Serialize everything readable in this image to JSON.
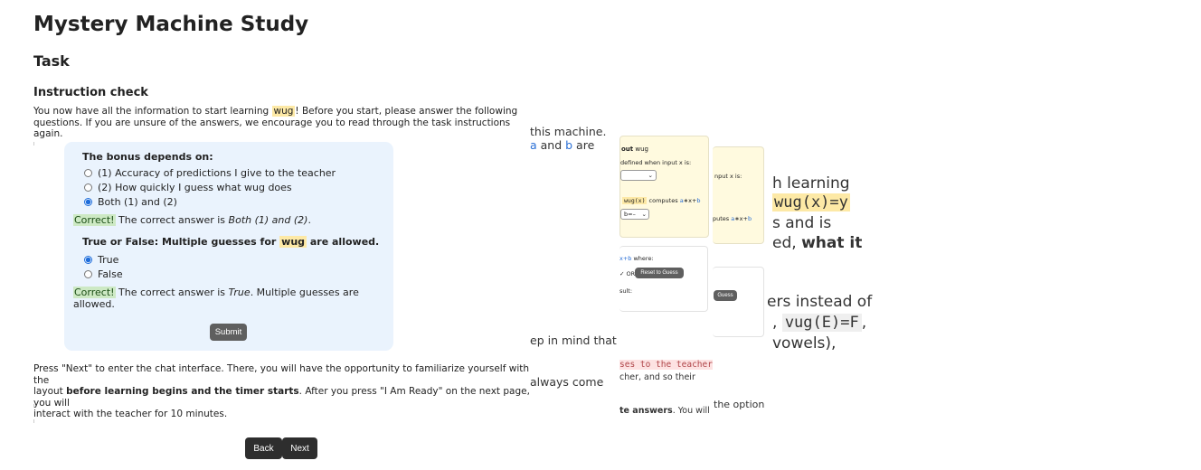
{
  "page": {
    "title": "Mystery Machine Study",
    "section": "Task",
    "subsection": "Instruction check",
    "intro": {
      "before": "You now have all the information to start learning ",
      "word": "wug",
      "after": "! Before you start, please answer the following",
      "line2": "questions. If you are unsure of the answers, we encourage you to read through the task instructions again."
    }
  },
  "quiz": {
    "q1": {
      "question": "The bonus depends on:",
      "options": [
        "(1) Accuracy of predictions I give to the teacher",
        "(2) How quickly I guess what wug does",
        "Both (1) and (2)"
      ],
      "selected": 2,
      "feedback_tag": "Correct!",
      "feedback_before": " The correct answer is ",
      "feedback_answer": "Both (1) and (2)",
      "feedback_after": "."
    },
    "q2": {
      "question_before": "True or False: Multiple guesses for ",
      "question_word": "wug",
      "question_after": " are allowed.",
      "options": [
        "True",
        "False"
      ],
      "selected": 0,
      "feedback_tag": "Correct!",
      "feedback_before": " The correct answer is ",
      "feedback_answer": "True",
      "feedback_after": ". Multiple guesses are allowed."
    },
    "submit_label": "Submit"
  },
  "outro": {
    "line1": "Press \"Next\" to enter the chat interface. There, you will have the opportunity to familiarize yourself with the",
    "line2_before": "layout ",
    "line2_bold": "before learning begins and the timer starts",
    "line2_after": ". After you press \"I Am Ready\" on the next page, you will",
    "line3": "interact with the teacher for 10 minutes."
  },
  "nav": {
    "back_label": "Back",
    "next_label": "Next"
  },
  "background": {
    "t1": "this machine.",
    "t2_a": "a",
    "t2_mid": " and ",
    "t2_b": "b",
    "t2_end": " are",
    "t3": "ep in mind that",
    "t4": "always come",
    "big1": "h learning",
    "big2": "wug(x)=y",
    "big3": "s and is",
    "big4_before": "ed, ",
    "big4_bold": "what it",
    "big5": "ers instead of",
    "big6_pre": ", ",
    "big6_code": "vug(E)=F",
    "big6_post": ",",
    "big7": "vowels),",
    "card1_title_bold": "out",
    "card1_title_word": "wug",
    "card1_line": "defined when input x is:",
    "card1_compute_word": "wug(x)",
    "card1_compute_text": " computes ",
    "card1_compute_a": "a",
    "card1_compute_op1": "∗x+",
    "card1_compute_b": "b",
    "card1_select": "b=–",
    "card2_line": "nput x is:",
    "card2_compute": "putes ",
    "card2_a": "a",
    "card2_op": "∗x+",
    "card2_b": "b",
    "card3_line_b": "x+b",
    "card3_line_where": " where:",
    "card3_or": "OR",
    "card3_reset": "Reset to Guess",
    "card3_result": "sult:",
    "card4_btn": "Guess",
    "pink_text": "ses to the teacher",
    "t5": "cher, and so their",
    "t6_bold": "te answers",
    "t6_after": ". You will",
    "t7": "the option"
  }
}
